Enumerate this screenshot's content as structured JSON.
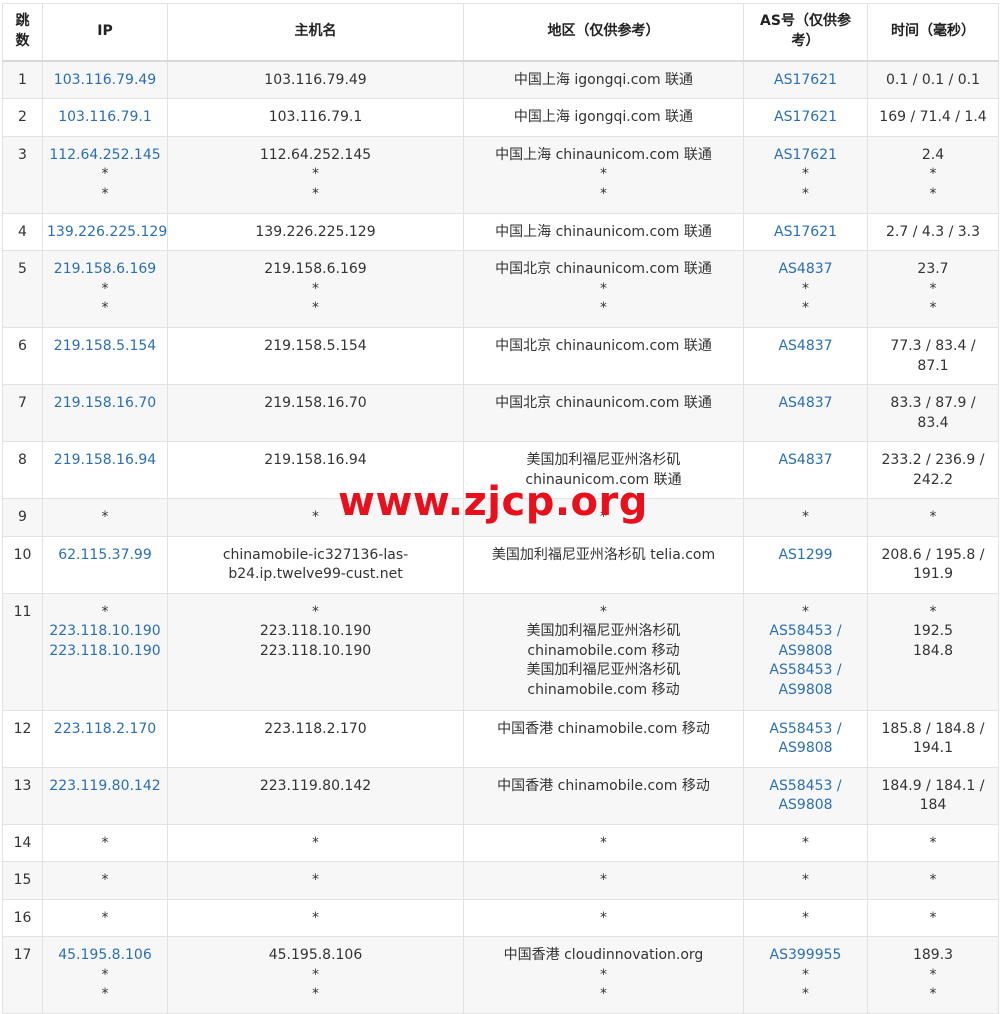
{
  "columns": [
    "跳数",
    "IP",
    "主机名",
    "地区（仅供参考）",
    "AS号（仅供参考）",
    "时间（毫秒）"
  ],
  "rows": [
    {
      "hop": "1",
      "ip": [
        "103.116.79.49"
      ],
      "host": [
        "103.116.79.49"
      ],
      "region": [
        "中国上海 igongqi.com 联通"
      ],
      "as": [
        "AS17621"
      ],
      "time": [
        "0.1 / 0.1 / 0.1"
      ]
    },
    {
      "hop": "2",
      "ip": [
        "103.116.79.1"
      ],
      "host": [
        "103.116.79.1"
      ],
      "region": [
        "中国上海 igongqi.com 联通"
      ],
      "as": [
        "AS17621"
      ],
      "time": [
        "169 / 71.4 / 1.4"
      ]
    },
    {
      "hop": "3",
      "ip": [
        "112.64.252.145",
        "*",
        "*"
      ],
      "host": [
        "112.64.252.145",
        "*",
        "*"
      ],
      "region": [
        "中国上海 chinaunicom.com 联通",
        "*",
        "*"
      ],
      "as": [
        "AS17621",
        "*",
        "*"
      ],
      "time": [
        "2.4",
        "*",
        "*"
      ]
    },
    {
      "hop": "4",
      "ip": [
        "139.226.225.129"
      ],
      "host": [
        "139.226.225.129"
      ],
      "region": [
        "中国上海 chinaunicom.com 联通"
      ],
      "as": [
        "AS17621"
      ],
      "time": [
        "2.7 / 4.3 / 3.3"
      ]
    },
    {
      "hop": "5",
      "ip": [
        "219.158.6.169",
        "*",
        "*"
      ],
      "host": [
        "219.158.6.169",
        "*",
        "*"
      ],
      "region": [
        "中国北京 chinaunicom.com 联通",
        "*",
        "*"
      ],
      "as": [
        "AS4837",
        "*",
        "*"
      ],
      "time": [
        "23.7",
        "*",
        "*"
      ]
    },
    {
      "hop": "6",
      "ip": [
        "219.158.5.154"
      ],
      "host": [
        "219.158.5.154"
      ],
      "region": [
        "中国北京 chinaunicom.com 联通"
      ],
      "as": [
        "AS4837"
      ],
      "time": [
        "77.3 / 83.4 /",
        "87.1"
      ]
    },
    {
      "hop": "7",
      "ip": [
        "219.158.16.70"
      ],
      "host": [
        "219.158.16.70"
      ],
      "region": [
        "中国北京 chinaunicom.com 联通"
      ],
      "as": [
        "AS4837"
      ],
      "time": [
        "83.3 / 87.9 /",
        "83.4"
      ]
    },
    {
      "hop": "8",
      "ip": [
        "219.158.16.94"
      ],
      "host": [
        "219.158.16.94"
      ],
      "region": [
        "美国加利福尼亚州洛杉矶",
        "chinaunicom.com 联通"
      ],
      "as": [
        "AS4837"
      ],
      "time": [
        "233.2 / 236.9 /",
        "242.2"
      ]
    },
    {
      "hop": "9",
      "ip": [
        "*"
      ],
      "host": [
        "*"
      ],
      "region": [
        "*"
      ],
      "as": [
        "*"
      ],
      "time": [
        "*"
      ]
    },
    {
      "hop": "10",
      "ip": [
        "62.115.37.99"
      ],
      "host": [
        "chinamobile-ic327136-las-",
        "b24.ip.twelve99-cust.net"
      ],
      "region": [
        "美国加利福尼亚州洛杉矶 telia.com"
      ],
      "as": [
        "AS1299"
      ],
      "time": [
        "208.6 / 195.8 /",
        "191.9"
      ]
    },
    {
      "hop": "11",
      "ip": [
        "*",
        "223.118.10.190",
        "223.118.10.190"
      ],
      "host": [
        "*",
        "223.118.10.190",
        "223.118.10.190"
      ],
      "region": [
        "*",
        "美国加利福尼亚州洛杉矶",
        "chinamobile.com 移动",
        "美国加利福尼亚州洛杉矶",
        "chinamobile.com 移动"
      ],
      "as": [
        "*",
        "AS58453 /",
        "AS9808",
        "AS58453 /",
        "AS9808"
      ],
      "time": [
        "*",
        "192.5",
        "184.8"
      ]
    },
    {
      "hop": "12",
      "ip": [
        "223.118.2.170"
      ],
      "host": [
        "223.118.2.170"
      ],
      "region": [
        "中国香港 chinamobile.com 移动"
      ],
      "as": [
        "AS58453 /",
        "AS9808"
      ],
      "time": [
        "185.8 / 184.8 /",
        "194.1"
      ]
    },
    {
      "hop": "13",
      "ip": [
        "223.119.80.142"
      ],
      "host": [
        "223.119.80.142"
      ],
      "region": [
        "中国香港 chinamobile.com 移动"
      ],
      "as": [
        "AS58453 /",
        "AS9808"
      ],
      "time": [
        "184.9 / 184.1 /",
        "184"
      ]
    },
    {
      "hop": "14",
      "ip": [
        "*"
      ],
      "host": [
        "*"
      ],
      "region": [
        "*"
      ],
      "as": [
        "*"
      ],
      "time": [
        "*"
      ]
    },
    {
      "hop": "15",
      "ip": [
        "*"
      ],
      "host": [
        "*"
      ],
      "region": [
        "*"
      ],
      "as": [
        "*"
      ],
      "time": [
        "*"
      ]
    },
    {
      "hop": "16",
      "ip": [
        "*"
      ],
      "host": [
        "*"
      ],
      "region": [
        "*"
      ],
      "as": [
        "*"
      ],
      "time": [
        "*"
      ]
    },
    {
      "hop": "17",
      "ip": [
        "45.195.8.106",
        "*",
        "*"
      ],
      "host": [
        "45.195.8.106",
        "*",
        "*"
      ],
      "region": [
        "中国香港 cloudinnovation.org",
        "*",
        "*"
      ],
      "as": [
        "AS399955",
        "*",
        "*"
      ],
      "time": [
        "189.3",
        "*",
        "*"
      ]
    }
  ],
  "watermark": "www.zjcp.org",
  "colors": {
    "link": "#2a6fb5",
    "watermark": "#e8101c",
    "stripe": "#f7f7f7",
    "border": "#e2e2e2"
  }
}
